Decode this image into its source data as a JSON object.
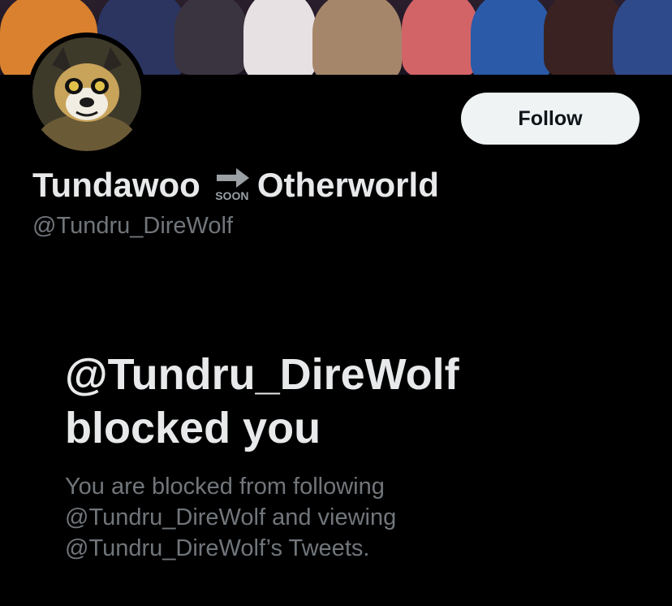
{
  "profile": {
    "display_name_part1": "Tundawoo",
    "emoji_name": "soon-arrow-icon",
    "emoji_text": "SOON",
    "display_name_part2": "Otherworld",
    "handle": "@Tundru_DireWolf"
  },
  "actions": {
    "follow_label": "Follow"
  },
  "blocked": {
    "title_line1": "@Tundru_DireWolf",
    "title_line2": "blocked you",
    "desc_line1": "You are blocked from following",
    "desc_line2": "@Tundru_DireWolf and viewing",
    "desc_line3": "@Tundru_DireWolf’s Tweets."
  },
  "colors": {
    "background": "#000000",
    "primary_text": "#e7e9ea",
    "secondary_text": "#71767b",
    "follow_button_bg": "#eff3f4",
    "follow_button_text": "#0f1419"
  }
}
